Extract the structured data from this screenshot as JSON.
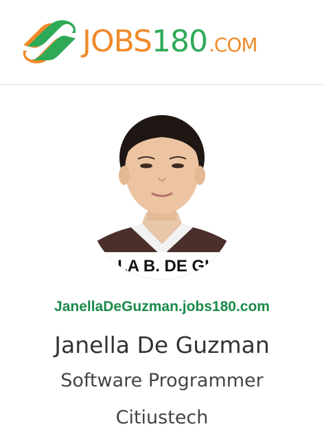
{
  "header": {
    "logo": {
      "word": "JOBS",
      "number": "180",
      "suffix": ".COM",
      "icon": "jobs180-logo-icon",
      "colors": {
        "orange": "#f08a2a",
        "green": "#2eaa57"
      }
    }
  },
  "profile": {
    "photo_caption": "LLA B. DE GU",
    "subdomain": "JanellaDeGuzman.jobs180.com",
    "name": "Janella De Guzman",
    "title": "Software Programmer",
    "company": "Citiustech",
    "link_color": "#1a8a4a"
  }
}
